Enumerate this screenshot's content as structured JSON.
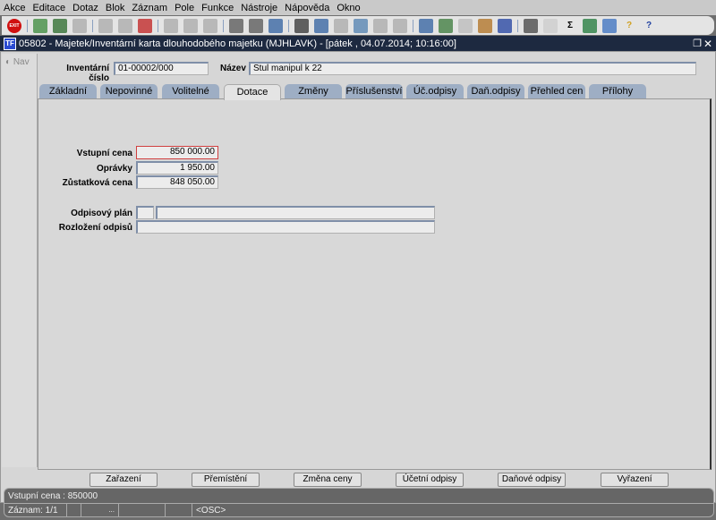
{
  "menu": [
    "Akce",
    "Editace",
    "Dotaz",
    "Blok",
    "Záznam",
    "Pole",
    "Funkce",
    "Nástroje",
    "Nápověda",
    "Okno"
  ],
  "toolbar": [
    {
      "icon": "exit-icon",
      "label": "EXIT",
      "color": "#d01010"
    },
    {
      "icon": "insert-record-icon",
      "color": "#3a8a3a"
    },
    {
      "icon": "save-record-icon",
      "color": "#2a6a2a"
    },
    {
      "icon": "delete-record-icon",
      "color": "#aaaaaa"
    },
    {
      "icon": "copy-icon",
      "color": "#aaaaaa"
    },
    {
      "icon": "paste-icon",
      "color": "#aaaaaa"
    },
    {
      "icon": "clear-icon",
      "color": "#c02020"
    },
    {
      "icon": "sort-asc-icon",
      "color": "#aaaaaa"
    },
    {
      "icon": "sort-desc-icon",
      "color": "#aaaaaa"
    },
    {
      "icon": "filter-icon",
      "color": "#aaaaaa"
    },
    {
      "icon": "print-icon",
      "color": "#555555"
    },
    {
      "icon": "print-preview-icon",
      "color": "#555555"
    },
    {
      "icon": "mail-icon",
      "color": "#3060a0"
    },
    {
      "icon": "cut-icon",
      "color": "#333333"
    },
    {
      "icon": "translate-icon",
      "color": "#3060a0"
    },
    {
      "icon": "swap-icon",
      "color": "#aaaaaa"
    },
    {
      "icon": "search-icon",
      "color": "#5080b0"
    },
    {
      "icon": "list-icon",
      "color": "#aaaaaa"
    },
    {
      "icon": "columns-icon",
      "color": "#aaaaaa"
    },
    {
      "icon": "export-icon",
      "color": "#3060a0"
    },
    {
      "icon": "document-icon",
      "color": "#3a7a3a"
    },
    {
      "icon": "globe-icon",
      "color": "#bbbbbb"
    },
    {
      "icon": "wheel-icon",
      "color": "#b07020"
    },
    {
      "icon": "pyramid-icon",
      "color": "#2040a0"
    },
    {
      "icon": "chart-icon",
      "color": "#444444"
    },
    {
      "icon": "clock-icon",
      "color": "#cccccc"
    },
    {
      "icon": "sum-icon",
      "label": "Σ",
      "color": "#000000"
    },
    {
      "icon": "excel-icon",
      "color": "#1f7a3a"
    },
    {
      "icon": "word-icon",
      "color": "#3a70c0"
    },
    {
      "icon": "help-icon",
      "label": "?",
      "color": "#d0a020"
    },
    {
      "icon": "context-help-icon",
      "label": "?",
      "color": "#2040a0"
    }
  ],
  "title": "05802 - Majetek/Inventární karta dlouhodobého majetku (MJHLAVK) - [pátek  , 04.07.2014; 10:16:00]",
  "nav_label": "Nav",
  "header": {
    "inv_label": "Inventární číslo",
    "inv_value": "01-00002/000",
    "name_label": "Název",
    "name_value": "Stul manipul k 22"
  },
  "tabs": [
    "Základní",
    "Nepovinné",
    "Volitelné",
    "Dotace",
    "Změny",
    "Příslušenství",
    "Úč.odpisy",
    "Daň.odpisy",
    "Přehled cen",
    "Přílohy"
  ],
  "active_tab": "Dotace",
  "fields": {
    "vstupni_label": "Vstupní cena",
    "vstupni": "850 000.00",
    "opravky_label": "Oprávky",
    "opravky": "1 950.00",
    "zustatkova_label": "Zůstatková cena",
    "zustatkova": "848 050.00",
    "plan_label": "Odpisový plán",
    "plan_code": "",
    "plan_name": "",
    "rozlozeni_label": "Rozložení odpisů",
    "rozlozeni": ""
  },
  "buttons": [
    "Zařazení",
    "Přemístění",
    "Změna ceny",
    "Účetní odpisy",
    "Daňové odpisy",
    "Vyřazení"
  ],
  "status": {
    "message": "Vstupní cena : 850000",
    "record": "Záznam: 1/1",
    "dots": "...",
    "mode": "<OSC>"
  }
}
